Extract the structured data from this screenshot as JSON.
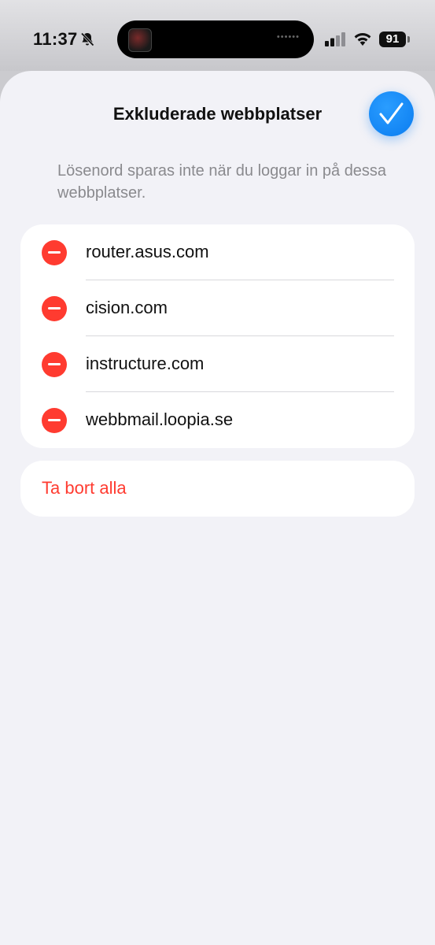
{
  "status_bar": {
    "time": "11:37",
    "battery": "91",
    "bell_icon": "bell-slash-icon",
    "signal_icon": "cellular-signal-icon",
    "wifi_icon": "wifi-icon"
  },
  "sheet": {
    "title": "Exkluderade webbplatser",
    "done_icon": "checkmark-icon",
    "description": "Lösenord sparas inte när du loggar in på dessa webbplatser.",
    "sites": [
      {
        "label": "router.asus.com"
      },
      {
        "label": "cision.com"
      },
      {
        "label": "instructure.com"
      },
      {
        "label": "webbmail.loopia.se"
      }
    ],
    "delete_all_label": "Ta bort alla"
  },
  "colors": {
    "accent": "#0a7cf0",
    "destructive": "#ff3b30",
    "sheet_background": "#f2f2f7"
  }
}
